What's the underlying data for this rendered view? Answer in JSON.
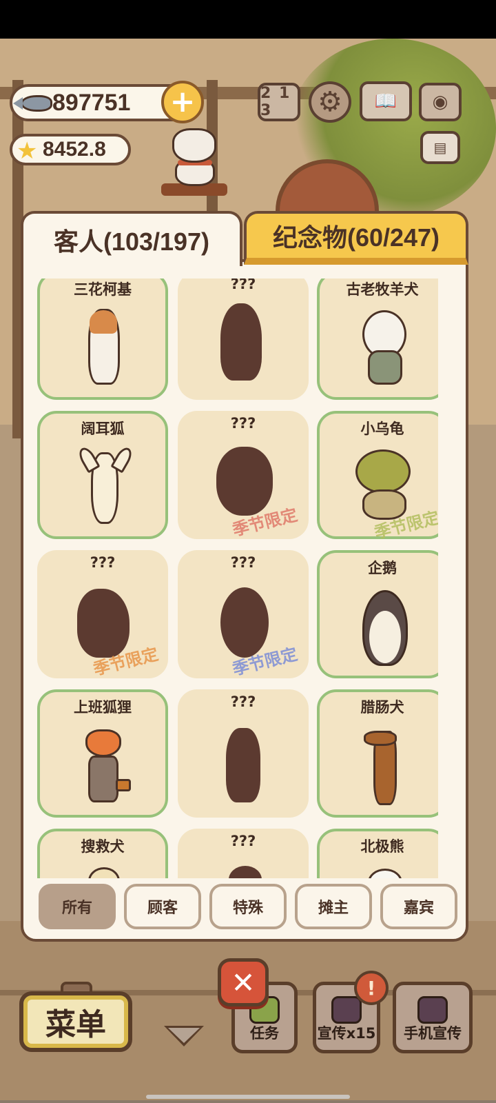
{
  "currency": {
    "fish": "897751",
    "stars": "8452.8"
  },
  "hud": {
    "leaderboard_glyph": "2 1 3",
    "news_glyph": "▤"
  },
  "tabs": {
    "guests": "客人(103/197)",
    "souvenirs": "纪念物(60/247)"
  },
  "seasonal_label": "季节限定",
  "cards": [
    {
      "name": "三花柯基",
      "unlocked": true
    },
    {
      "name": "???",
      "unlocked": false
    },
    {
      "name": "古老牧羊犬",
      "unlocked": true
    },
    {
      "name": "阔耳狐",
      "unlocked": true
    },
    {
      "name": "???",
      "unlocked": false,
      "seasonal": true
    },
    {
      "name": "小乌龟",
      "unlocked": true,
      "seasonal": true
    },
    {
      "name": "???",
      "unlocked": false,
      "seasonal": true
    },
    {
      "name": "???",
      "unlocked": false,
      "seasonal": true
    },
    {
      "name": "企鹅",
      "unlocked": true
    },
    {
      "name": "上班狐狸",
      "unlocked": true
    },
    {
      "name": "???",
      "unlocked": false
    },
    {
      "name": "腊肠犬",
      "unlocked": true
    },
    {
      "name": "搜救犬",
      "unlocked": true
    },
    {
      "name": "???",
      "unlocked": false
    },
    {
      "name": "北极熊",
      "unlocked": true
    }
  ],
  "filters": {
    "all": "所有",
    "customers": "顾客",
    "special": "特殊",
    "vendors": "摊主",
    "guests": "嘉宾"
  },
  "bottom": {
    "menu": "菜单",
    "close": "✕",
    "task": "任务",
    "promo": "宣传x15",
    "phone_promo": "手机宣传",
    "alert": "!"
  }
}
